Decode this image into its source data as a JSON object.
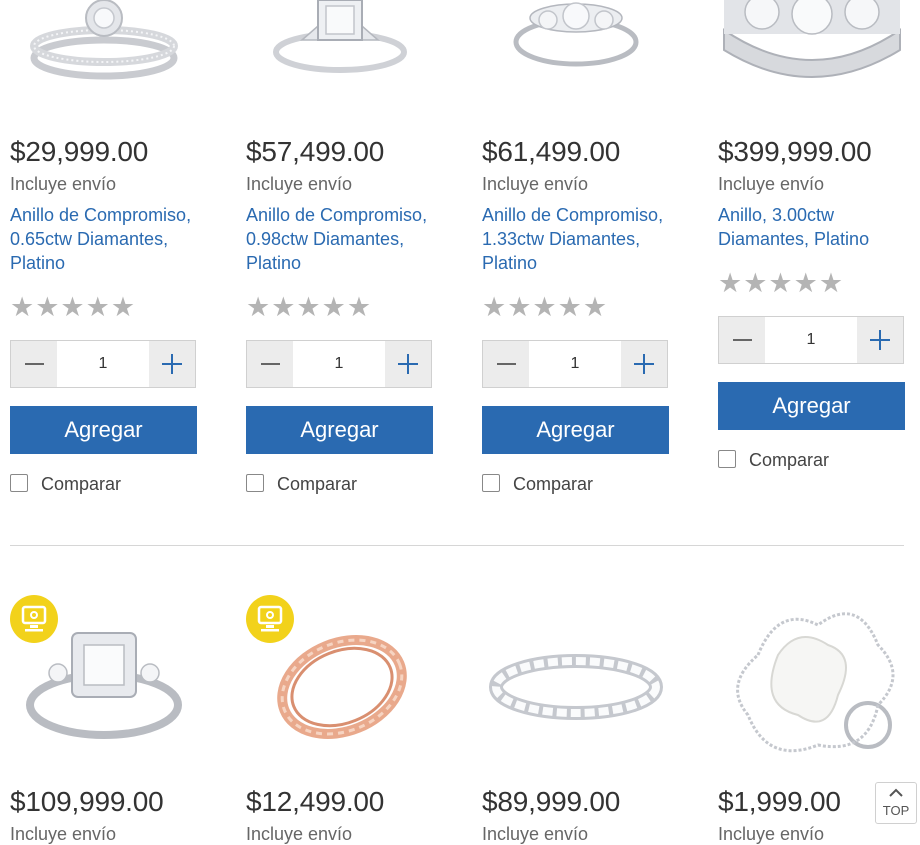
{
  "row1": [
    {
      "price": "$29,999.00",
      "shipping": "Incluye envío",
      "title": "Anillo de Compromiso, 0.65ctw Diamantes, Platino",
      "image": "halo-diamond-ring-set",
      "qty": "1",
      "add_label": "Agregar",
      "compare_label": "Comparar",
      "rating": 0,
      "stars": "★★★★★"
    },
    {
      "price": "$57,499.00",
      "shipping": "Incluye envío",
      "title": "Anillo de Compromiso, 0.98ctw Diamantes, Platino",
      "image": "emerald-cut-diamond-ring",
      "qty": "1",
      "add_label": "Agregar",
      "compare_label": "Comparar",
      "rating": 0,
      "stars": "★★★★★"
    },
    {
      "price": "$61,499.00",
      "shipping": "Incluye envío",
      "title": "Anillo de Compromiso, 1.33ctw Diamantes, Platino",
      "image": "three-stone-diamond-ring",
      "qty": "1",
      "add_label": "Agregar",
      "compare_label": "Comparar",
      "rating": 0,
      "stars": "★★★★★"
    },
    {
      "price": "$399,999.00",
      "shipping": "Incluye envío",
      "title": "Anillo, 3.00ctw Diamantes, Platino",
      "image": "wide-diamond-band",
      "qty": "1",
      "add_label": "Agregar",
      "compare_label": "Comparar",
      "rating": 0,
      "stars": "★★★★★"
    }
  ],
  "row2": [
    {
      "price": "$109,999.00",
      "shipping": "Incluye envío",
      "image": "princess-halo-ring",
      "badge": "online-only-icon"
    },
    {
      "price": "$12,499.00",
      "shipping": "Incluye envío",
      "image": "rose-gold-twist-ring",
      "badge": "online-only-icon"
    },
    {
      "price": "$89,999.00",
      "shipping": "Incluye envío",
      "image": "eternity-diamond-band"
    },
    {
      "price": "$1,999.00",
      "shipping": "Incluye envío",
      "image": "pearl-flower-ring"
    }
  ],
  "top_button": {
    "label": "TOP"
  },
  "colors": {
    "link": "#2a6ab1",
    "button": "#2a6ab1",
    "stars": "#b4b4b4",
    "badge": "#f2d21b"
  }
}
